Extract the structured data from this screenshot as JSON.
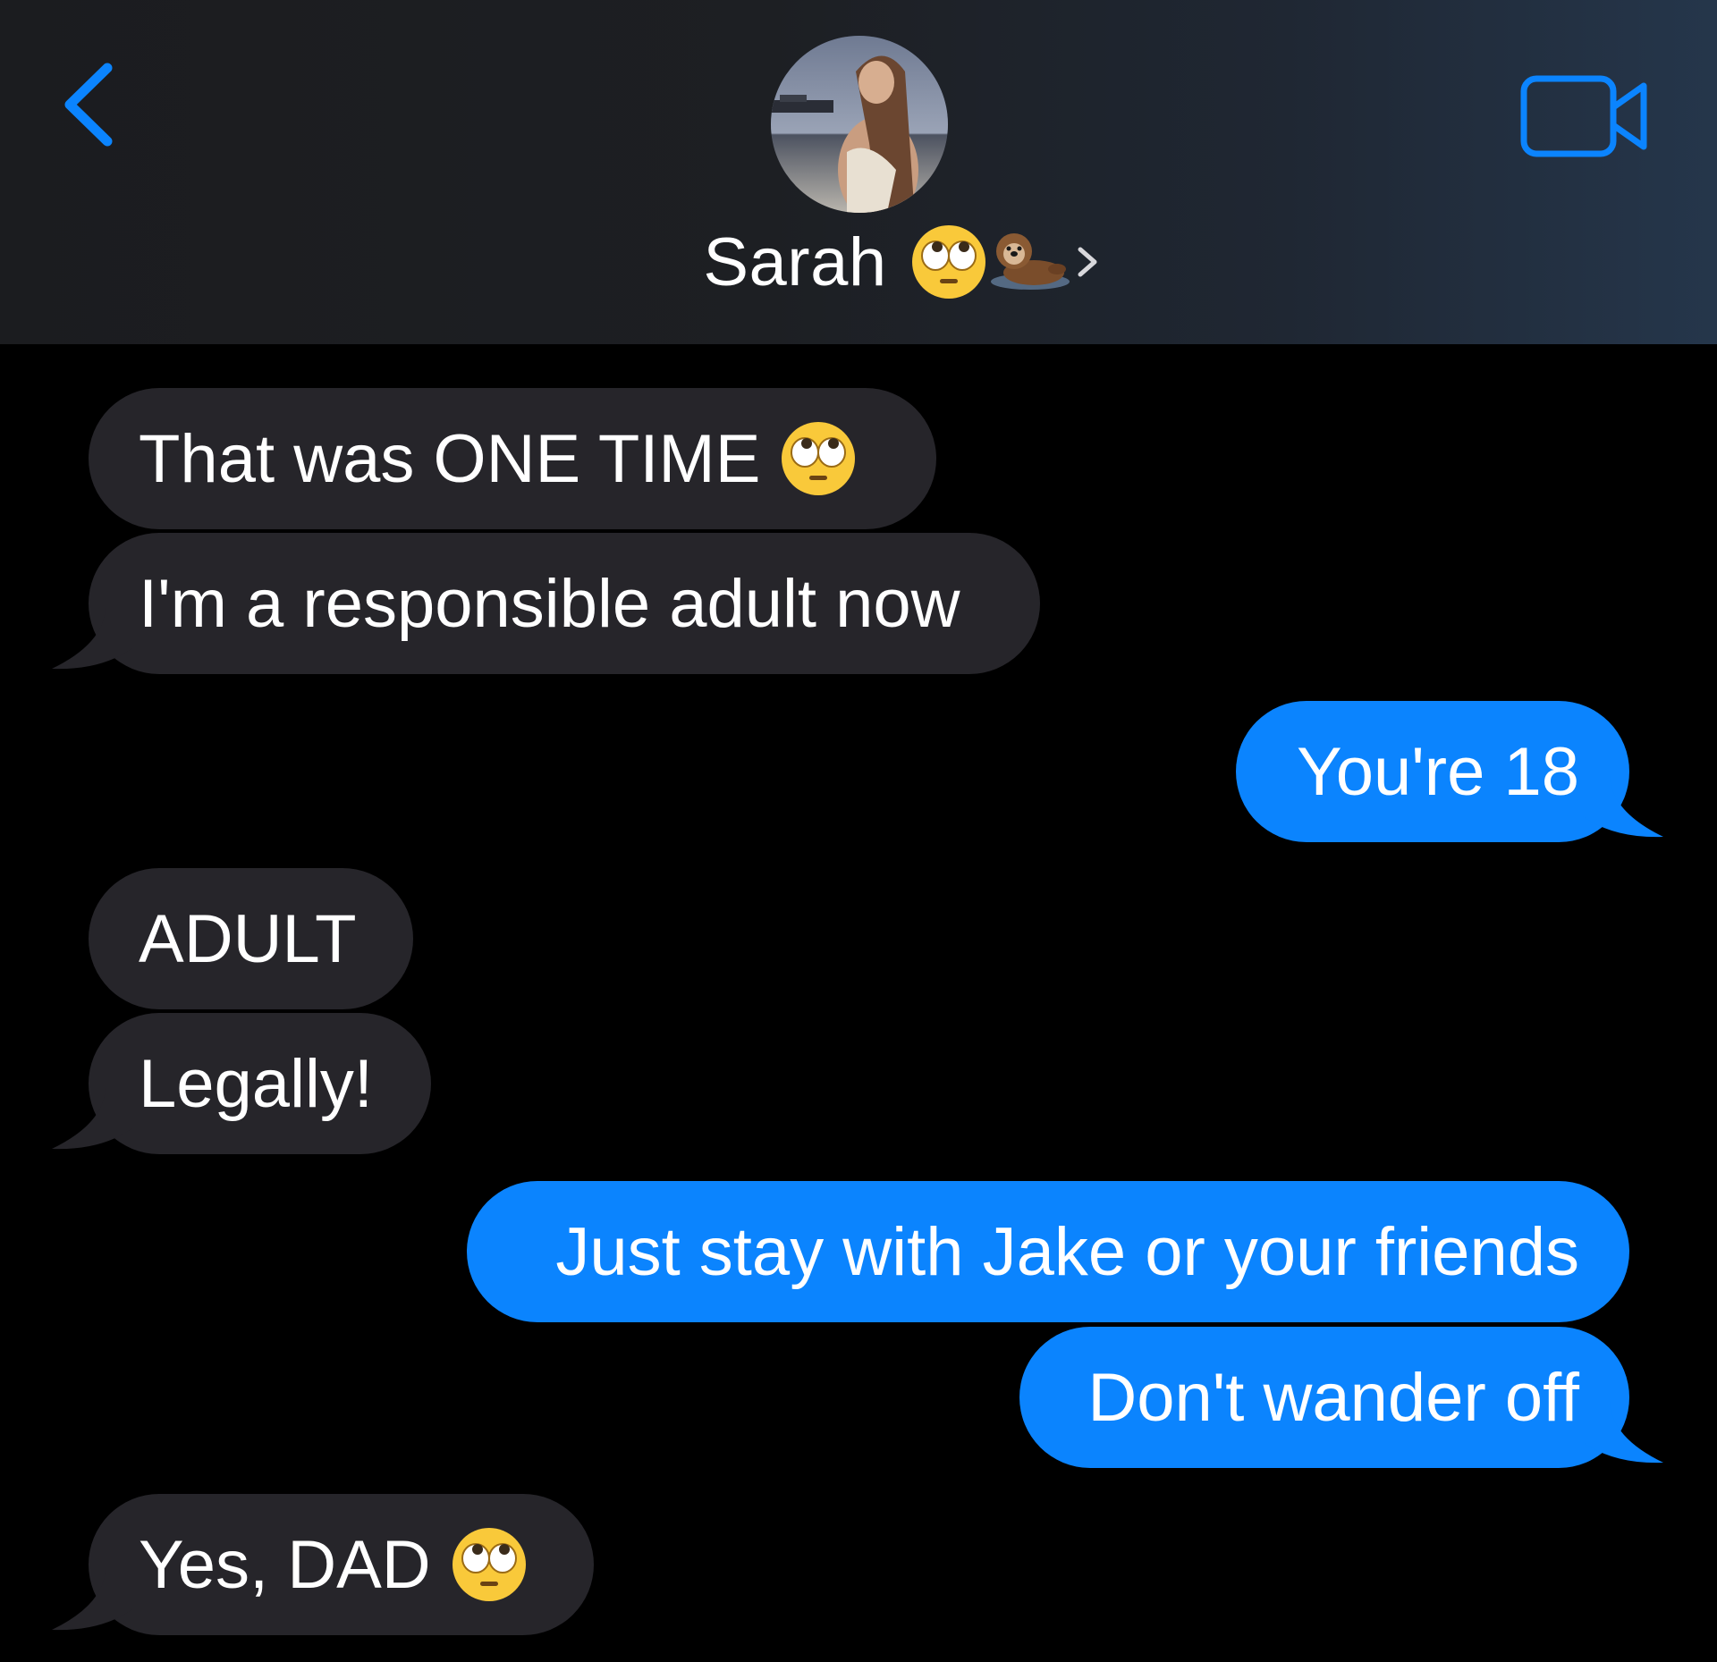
{
  "header": {
    "back_icon": "chevron-left-icon",
    "contact_name": "Sarah",
    "name_emojis": [
      "face-with-rolling-eyes-emoji",
      "otter-emoji"
    ],
    "disclosure_icon": "chevron-right-icon",
    "video_icon": "video-camera-icon",
    "accent_color": "#0b84fe"
  },
  "messages": [
    {
      "direction": "incoming",
      "text": "That was ONE TIME",
      "emoji": "face-with-rolling-eyes-emoji"
    },
    {
      "direction": "incoming",
      "text": "I'm a responsible adult now"
    },
    {
      "direction": "outgoing",
      "text": "You're 18"
    },
    {
      "direction": "incoming",
      "text": "ADULT"
    },
    {
      "direction": "incoming",
      "text": "Legally!"
    },
    {
      "direction": "outgoing",
      "text": "Just stay with Jake or your friends"
    },
    {
      "direction": "outgoing",
      "text": "Don't wander off"
    },
    {
      "direction": "incoming",
      "text": "Yes, DAD",
      "emoji": "face-with-rolling-eyes-emoji"
    }
  ],
  "colors": {
    "incoming_bubble": "#26252a",
    "outgoing_bubble": "#0b84fe",
    "background": "#000000"
  }
}
